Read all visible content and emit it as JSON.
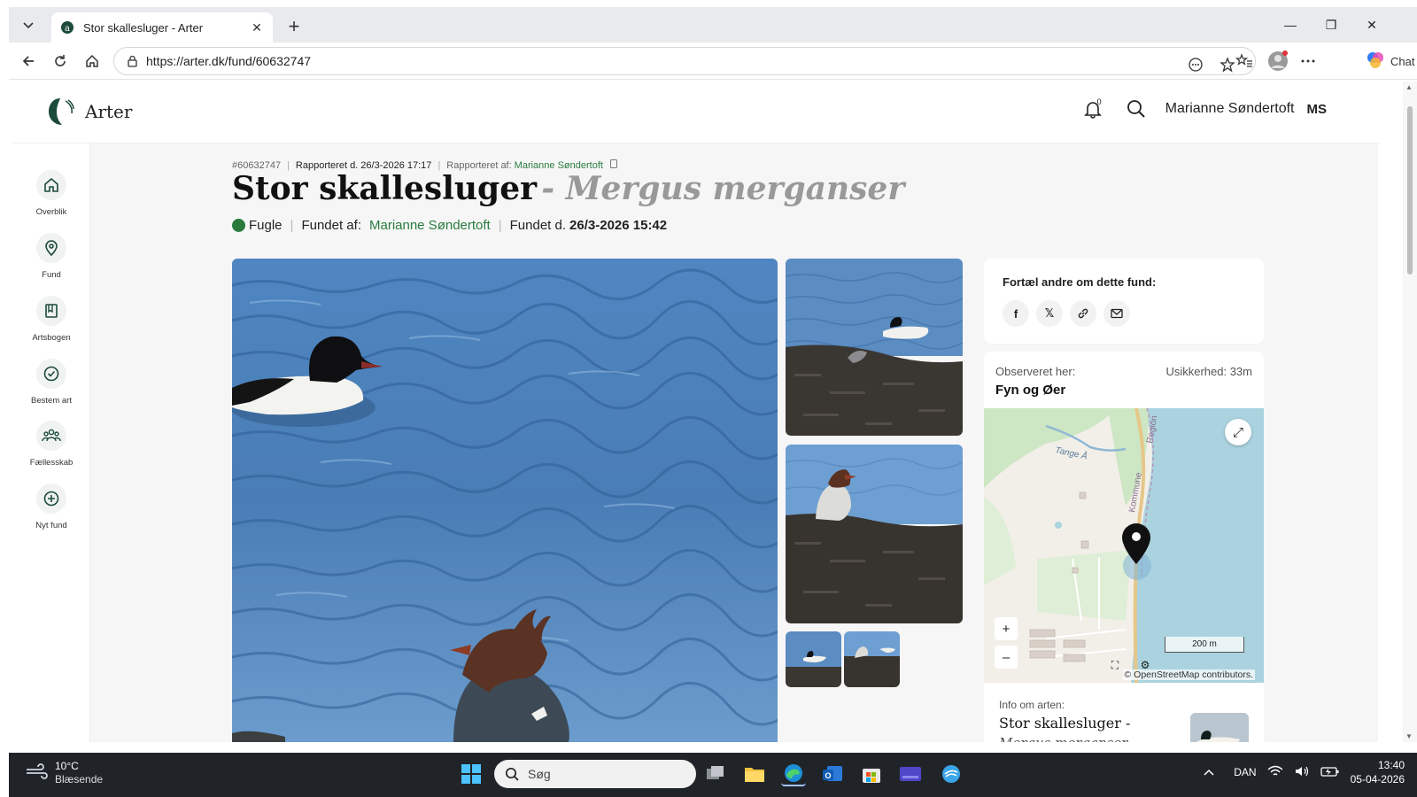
{
  "browser": {
    "tab_title": "Stor skallesluger - Arter",
    "url": "https://arter.dk/fund/60632747",
    "chat_label": "Chat",
    "favicon_color": "#1c4a3b"
  },
  "site": {
    "brand": "Arter",
    "notification_count": "0",
    "user_name": "Marianne Søndertoft",
    "user_initials": "MS",
    "accent_color": "#2a7a3e"
  },
  "sidebar": {
    "items": [
      {
        "label": "Overblik",
        "icon": "home-icon"
      },
      {
        "label": "Fund",
        "icon": "location-pin-icon"
      },
      {
        "label": "Artsbogen",
        "icon": "book-icon"
      },
      {
        "label": "Bestem art",
        "icon": "check-circle-icon"
      },
      {
        "label": "Fællesskab",
        "icon": "community-icon"
      },
      {
        "label": "Nyt fund",
        "icon": "plus-circle-icon"
      }
    ]
  },
  "record": {
    "id": "#60632747",
    "reported_on": "Rapporteret d. 26/3-2026 17:17",
    "reported_by_label": "Rapporteret af:",
    "reported_by": "Marianne Søndertoft",
    "common_name": "Stor skallesluger",
    "latin_name": "- Mergus merganser",
    "group": "Fugle",
    "found_by_label": "Fundet af:",
    "found_by": "Marianne Søndertoft",
    "found_on_label": "Fundet d.",
    "found_on": "26/3-2026 15:42"
  },
  "share": {
    "title": "Fortæl andre om dette fund:",
    "icons": [
      "facebook-icon",
      "x-icon",
      "link-icon",
      "mail-icon"
    ]
  },
  "location": {
    "label": "Observeret her:",
    "uncertainty": "Usikkerhed: 33m",
    "place": "Fyn og Øer",
    "map_labels": {
      "river": "Tange Å",
      "region": "Region",
      "municipality": "Kommune"
    },
    "scale": "200 m",
    "attribution": "© OpenStreetMap contributors."
  },
  "species_info": {
    "label": "Info om arten:",
    "name": "Stor skallesluger -",
    "latin": "Mergus merganser"
  },
  "taskbar": {
    "temperature": "10°C",
    "condition": "Blæsende",
    "search_placeholder": "Søg",
    "language": "DAN",
    "time": "13:40",
    "date": "05-04-2026"
  }
}
